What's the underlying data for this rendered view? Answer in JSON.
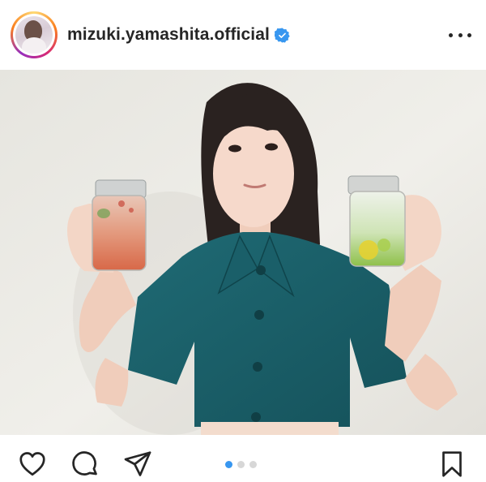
{
  "post": {
    "username": "mizuki.yamashita.official",
    "verified": true,
    "icons": {
      "avatar": "profile-avatar",
      "verified": "verified-badge-icon",
      "more": "more-options-icon",
      "like": "heart-icon",
      "comment": "comment-icon",
      "share": "paper-plane-icon",
      "save": "bookmark-icon"
    },
    "carousel": {
      "current": 1,
      "total": 3
    },
    "colors": {
      "accent": "#3897f0",
      "text": "#262626",
      "dot_inactive": "#d7d7d7"
    }
  }
}
